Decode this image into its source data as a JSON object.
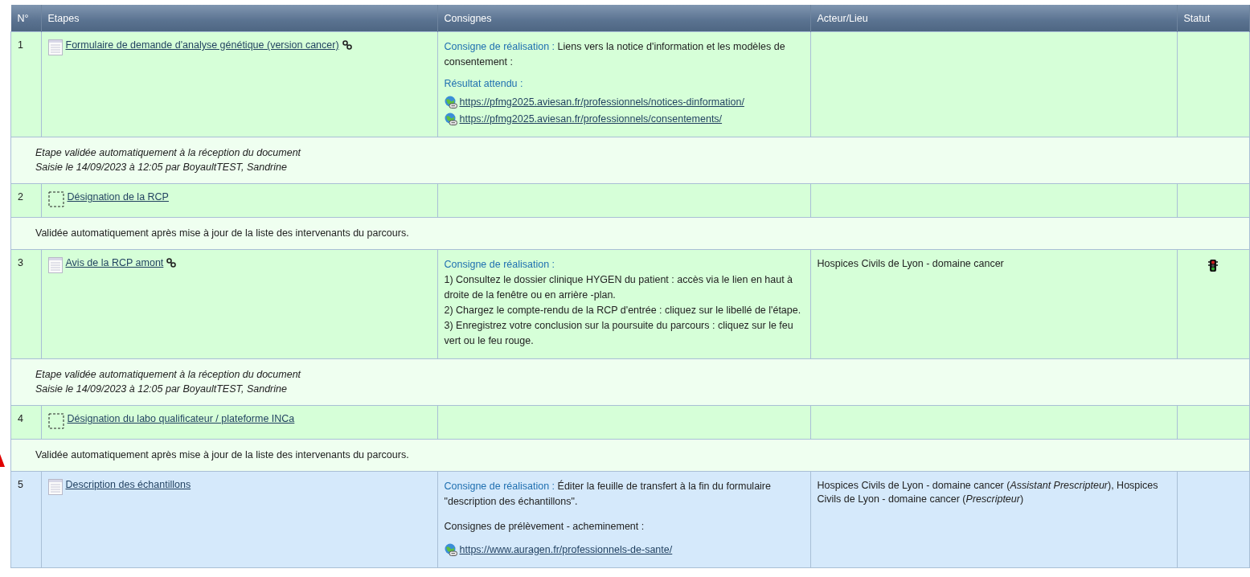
{
  "columns": [
    "N°",
    "Etapes",
    "Consignes",
    "Acteur/Lieu",
    "Statut"
  ],
  "rows": [
    {
      "kind": "step",
      "number": "1",
      "document": true,
      "label": "Formulaire de demande d'analyse génétique (version cancer)",
      "linked": true,
      "selected": false,
      "consignes": [
        {
          "kind": "instruction",
          "label": "Consigne de réalisation :",
          "text": "Liens vers la notice d'information et les modèles de consentement :"
        },
        {
          "kind": "label",
          "text": "Résultat attendu :"
        },
        {
          "kind": "links",
          "urls": [
            "https://pfmg2025.aviesan.fr/professionnels/notices-dinformation/",
            "https://pfmg2025.aviesan.fr/professionnels/consentements/"
          ]
        }
      ],
      "actor": "",
      "signal": false
    },
    {
      "kind": "note",
      "italic": true,
      "lines": [
        "Etape validée automatiquement à la réception du document",
        "Saisie le 14/09/2023 à 12:05 par BoyaultTEST, Sandrine"
      ]
    },
    {
      "kind": "step",
      "number": "2",
      "document": false,
      "label": "Désignation de la RCP",
      "linked": false,
      "selected": false,
      "consignes": [],
      "actor": "",
      "signal": false
    },
    {
      "kind": "note",
      "italic": false,
      "lines": [
        "Validée automatiquement après mise à jour de la liste des intervenants du parcours."
      ]
    },
    {
      "kind": "step",
      "number": "3",
      "document": true,
      "label": "Avis de la RCP amont",
      "linked": true,
      "selected": false,
      "consignes": [
        {
          "kind": "label",
          "text": "Consigne de réalisation :"
        },
        {
          "kind": "text",
          "text": "1) Consultez le dossier clinique HYGEN du patient : accès via le lien en haut à droite de la fenêtre ou en arrière -plan."
        },
        {
          "kind": "text",
          "text": "2) Chargez le compte-rendu de la RCP d'entrée : cliquez sur le libellé de l'étape."
        },
        {
          "kind": "text",
          "text": "3) Enregistrez votre conclusion sur la poursuite du parcours : cliquez sur le feu vert ou le feu rouge."
        }
      ],
      "actor": "Hospices Civils de Lyon - domaine cancer",
      "signal": true
    },
    {
      "kind": "note",
      "italic": true,
      "lines": [
        "Etape validée automatiquement à la réception du document",
        "Saisie le 14/09/2023 à 12:05 par BoyaultTEST, Sandrine"
      ]
    },
    {
      "kind": "step",
      "number": "4",
      "document": false,
      "label": "Désignation du labo qualificateur / plateforme INCa",
      "linked": false,
      "selected": false,
      "consignes": [],
      "actor": "",
      "signal": false
    },
    {
      "kind": "note",
      "italic": false,
      "lines": [
        "Validée automatiquement après mise à jour de la liste des intervenants du parcours."
      ]
    },
    {
      "kind": "step",
      "number": "5",
      "document": true,
      "label": "Description des échantillons",
      "linked": false,
      "selected": true,
      "consignes": [
        {
          "kind": "instruction",
          "label": "Consigne de réalisation :",
          "text": "Éditer la feuille de transfert à la fin du formulaire \"description des échantillons\"."
        },
        {
          "kind": "spacer_text",
          "text": "Consignes de prélèvement - acheminement :"
        },
        {
          "kind": "links",
          "urls": [
            "https://www.auragen.fr/professionnels-de-sante/"
          ]
        }
      ],
      "actor": "Hospices Civils de Lyon - domaine cancer (*Assistant Prescripteur*), Hospices Civils de Lyon - domaine cancer (*Prescripteur*)",
      "signal": false
    }
  ]
}
